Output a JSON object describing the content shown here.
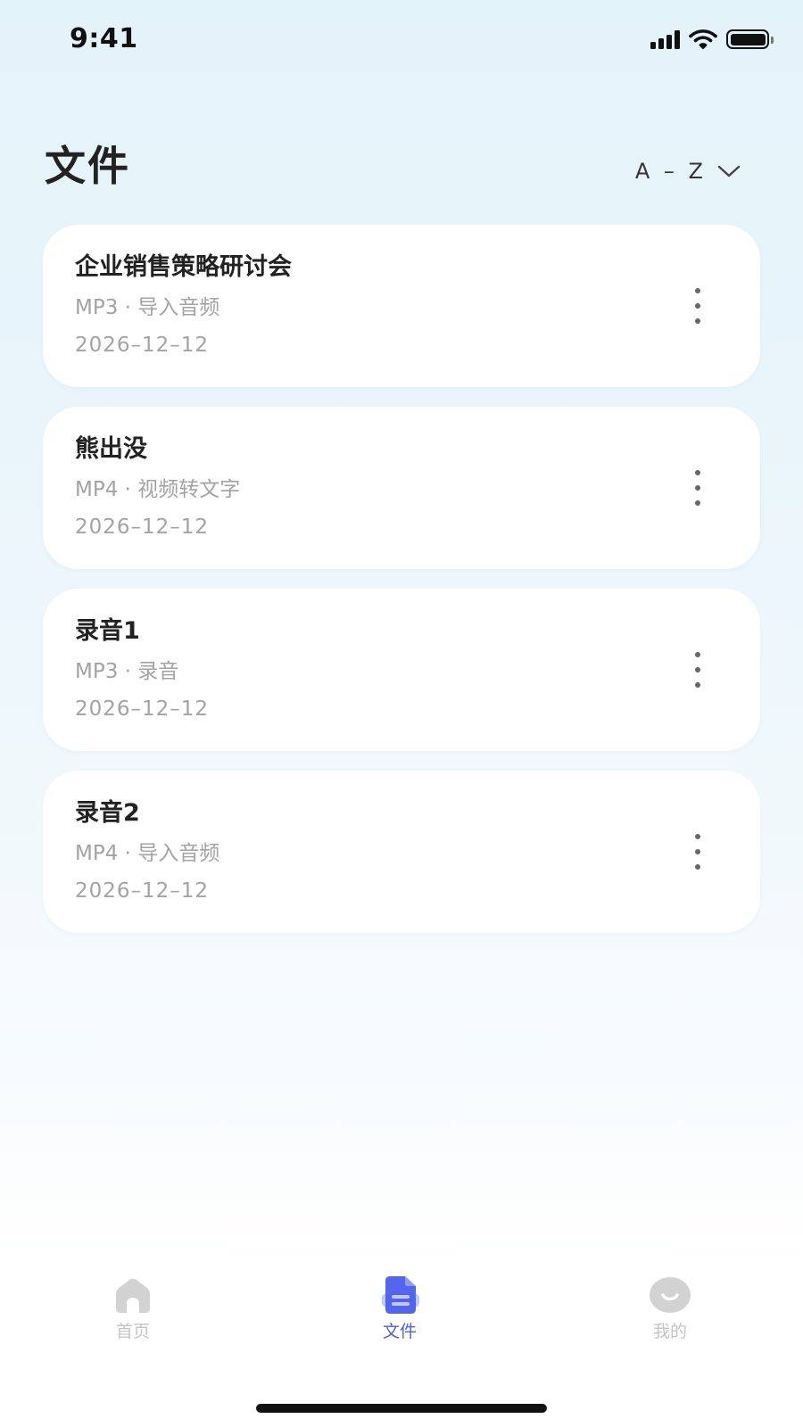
{
  "status_bar": {
    "time": "9:41",
    "icons": [
      "signal-icon",
      "wifi-icon",
      "battery-icon"
    ]
  },
  "header": {
    "title": "文件",
    "sort_label": "A – Z",
    "sort_icon": "chevron-down-icon"
  },
  "files": [
    {
      "name": "企业销售策略研讨会",
      "meta": "MP3 · 导入音频",
      "date": "2026–12–12"
    },
    {
      "name": "熊出没",
      "meta": "MP4 · 视频转文字",
      "date": "2026–12–12"
    },
    {
      "name": "录音1",
      "meta": "MP3 · 录音",
      "date": "2026–12–12"
    },
    {
      "name": "录音2",
      "meta": "MP4 · 导入音频",
      "date": "2026–12–12"
    }
  ],
  "tab_bar": {
    "tabs": [
      {
        "label": "首页",
        "icon": "home-icon",
        "active": false
      },
      {
        "label": "文件",
        "icon": "document-icon",
        "active": true
      },
      {
        "label": "我的",
        "icon": "smiley-profile-icon",
        "active": false
      }
    ]
  },
  "colors": {
    "accent": "#4e5fe8",
    "inactive_tab": "#c4c4c4",
    "secondary_text": "#a3a3a3",
    "card_background": "#ffffff"
  }
}
